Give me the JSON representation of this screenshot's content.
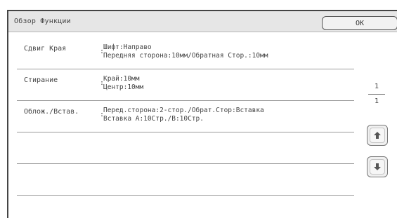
{
  "header": {
    "title": "Обзор Функции",
    "ok_label": "OK"
  },
  "rows": [
    {
      "label": "Сдвиг Края",
      "colon": ":",
      "value_line1": "Шифт:Направо",
      "value_line2": "Передняя сторона:10мм/Обратная Стор.:10мм"
    },
    {
      "label": "Стирание",
      "colon": ":",
      "value_line1": "Край:10мм",
      "value_line2": "Центр:10мм"
    },
    {
      "label": "Облож./Встав.",
      "colon": ":",
      "value_line1": "Перед.сторона:2-стор./Обрат.Стор:Вставка",
      "value_line2": "Вставка А:10Стр./В:10Стр."
    },
    {
      "label": "",
      "colon": "",
      "value_line1": "",
      "value_line2": ""
    },
    {
      "label": "",
      "colon": "",
      "value_line1": "",
      "value_line2": ""
    }
  ],
  "pager": {
    "current": "1",
    "total": "1"
  },
  "icons": {
    "up": "arrow-up-icon",
    "down": "arrow-down-icon"
  },
  "colors": {
    "titlebar_bg": "#e6e6e6",
    "frame_border": "#444444",
    "divider": "#9a9a9a"
  }
}
